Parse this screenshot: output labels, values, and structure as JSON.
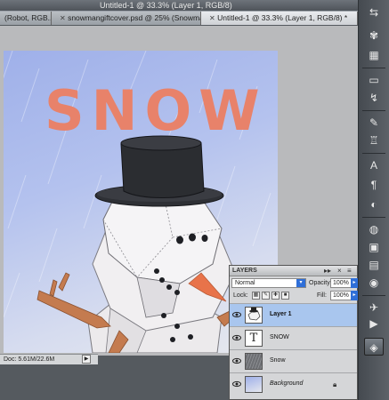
{
  "window": {
    "title": "Untitled-1 @ 33.3% (Layer 1, RGB/8)"
  },
  "tabs": [
    {
      "label": "(Robot, RGB...",
      "active": false
    },
    {
      "label": "snowmangiftcover.psd @ 25% (Snowman...",
      "active": false
    },
    {
      "label": "Untitled-1 @ 33.3% (Layer 1, RGB/8) *",
      "active": true
    }
  ],
  "canvas": {
    "artwork_text": "SNOW"
  },
  "status": {
    "doc": "Doc: 5.61M/22.6M",
    "menu_arrow": "▶"
  },
  "tools": {
    "icons": [
      "tool-arrange-icon",
      "tool-3d-icon",
      "tool-grid-icon",
      "tool-blank-icon",
      "tool-curve-icon",
      "tool-brush-icon",
      "tool-stamp-icon",
      "tool-text-icon",
      "tool-paragraph-icon",
      "tool-circle-icon",
      "tool-adjust-icon",
      "tool-mask-icon",
      "tool-image-icon",
      "tool-layers-icon",
      "tool-channels-icon",
      "tool-paths-icon",
      "tool-panel-icon"
    ]
  },
  "layers": {
    "panel_title": "LAYERS",
    "blend_mode": "Normal",
    "opacity_label": "Opacity:",
    "opacity_value": "100%",
    "lock_label": "Lock:",
    "fill_label": "Fill:",
    "fill_value": "100%",
    "items": [
      {
        "name": "Layer 1",
        "selected": true,
        "locked": false
      },
      {
        "name": "SNOW",
        "selected": false,
        "locked": false
      },
      {
        "name": "Snow",
        "selected": false,
        "locked": false
      },
      {
        "name": "Background",
        "selected": false,
        "locked": true
      }
    ]
  },
  "colors": {
    "artwork_text": "#e8826a",
    "hat": "#2b2d31",
    "nose": "#e8734a",
    "selection": "#a9c6ee"
  }
}
